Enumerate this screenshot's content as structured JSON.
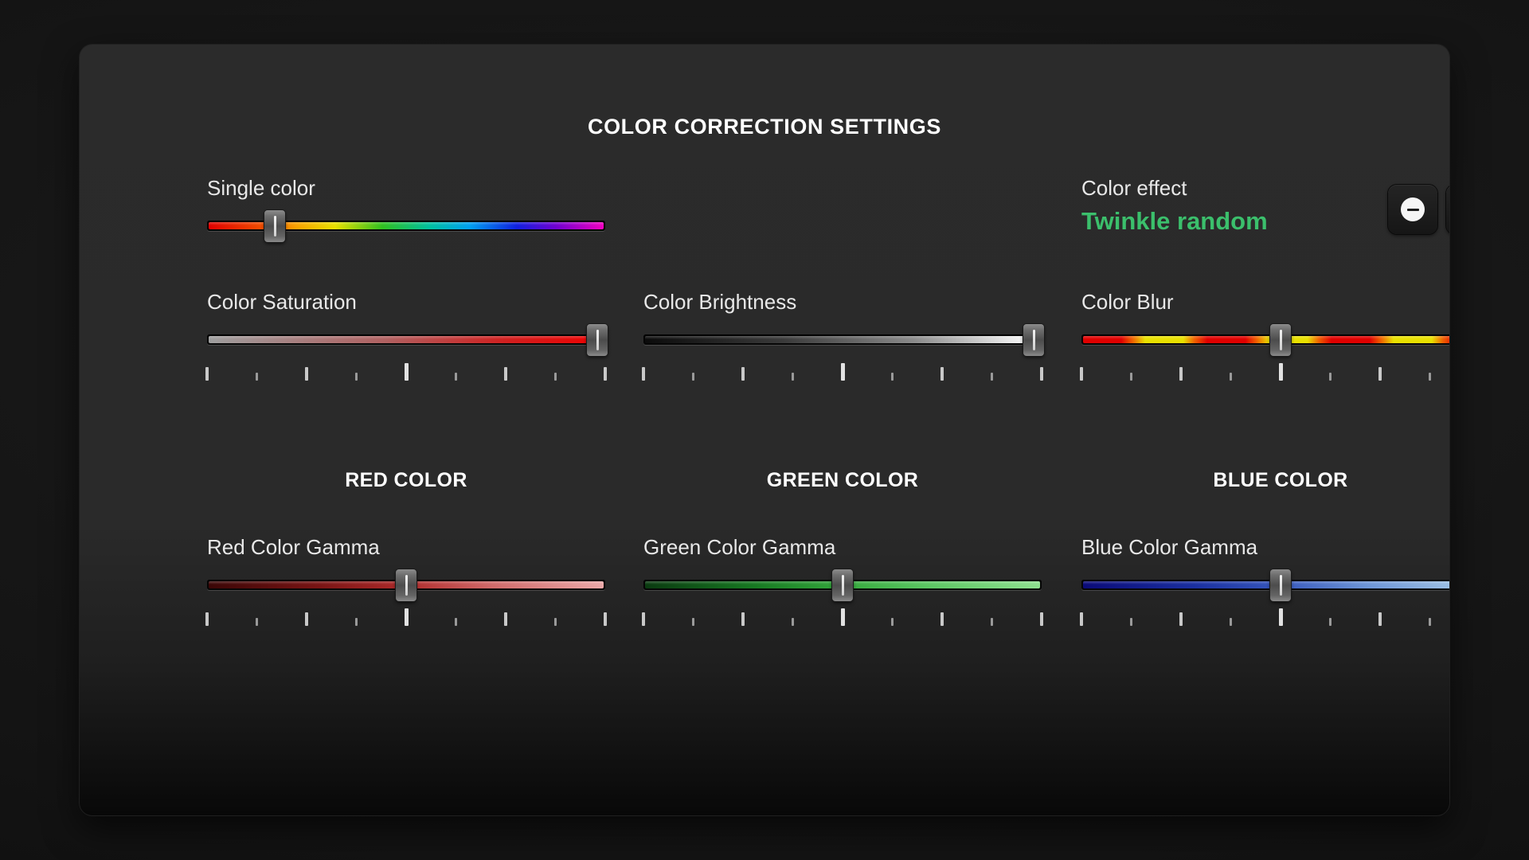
{
  "panel": {
    "title": "COLOR CORRECTION SETTINGS"
  },
  "single_color": {
    "label": "Single color",
    "value_percent": 17,
    "gradient": "linear-gradient(90deg,#e00000 0%,#f25000 14%,#f8a000 22%,#e8e000 32%,#30c020 44%,#00c0a0 56%,#00a0f0 66%,#1020e0 78%,#7000d0 88%,#f000c0 100%)"
  },
  "color_effect": {
    "label": "Color effect",
    "value": "Twinkle random",
    "value_color": "#3bbf6c",
    "decrement_label": "minus-icon",
    "increment_label": "plus-icon"
  },
  "sliders_row1": [
    {
      "name": "color-saturation",
      "label": "Color Saturation",
      "value_percent": 98,
      "gradient": "linear-gradient(90deg,#9e9e9e 0%,#b06060 45%,#d02020 75%,#f00000 100%)"
    },
    {
      "name": "color-brightness",
      "label": "Color Brightness",
      "value_percent": 98,
      "gradient": "linear-gradient(90deg,#0b0b0b 0%,#3a3a3a 35%,#8a8a8a 68%,#e8e8e8 92%,#ffffff 100%)"
    },
    {
      "name": "color-blur",
      "label": "Color Blur",
      "value_percent": 50,
      "gradient": "repeating-linear-gradient(90deg,#e00000 0px,#e00000 48px,#f06000 62px,#e8e000 78px,#e8e000 126px,#f06000 140px,#e00000 156px)"
    }
  ],
  "sections": [
    {
      "name": "red-color",
      "title": "RED COLOR"
    },
    {
      "name": "green-color",
      "title": "GREEN COLOR"
    },
    {
      "name": "blue-color",
      "title": "BLUE COLOR"
    }
  ],
  "sliders_row2": [
    {
      "name": "red-color-gamma",
      "label": "Red Color Gamma",
      "value_percent": 50,
      "gradient": "linear-gradient(90deg,#3a0606 0%,#7a1414 28%,#b02b2b 50%,#d06a6a 72%,#eba8a8 100%)"
    },
    {
      "name": "green-color-gamma",
      "label": "Green Color Gamma",
      "value_percent": 50,
      "gradient": "linear-gradient(90deg,#0a3a10 0%,#177a22 28%,#34a83c 50%,#5cc763 72%,#8ee08f 100%)"
    },
    {
      "name": "blue-color-gamma",
      "label": "Blue Color Gamma",
      "value_percent": 50,
      "gradient": "linear-gradient(90deg,#0a0a78 0%,#1a2fa0 28%,#3758bd 50%,#6d95d6 72%,#a9cbe8 100%)"
    }
  ],
  "tick_pattern": [
    "t-mid",
    "t-minor",
    "t-mid",
    "t-minor",
    "t-major",
    "t-minor",
    "t-mid",
    "t-minor",
    "t-mid"
  ]
}
